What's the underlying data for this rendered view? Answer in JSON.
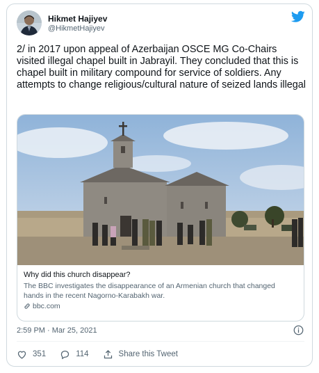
{
  "author": {
    "name": "Hikmet Hajiyev",
    "handle": "@HikmetHajiyev"
  },
  "tweet": {
    "text": "2/ in 2017 upon appeal of Azerbaijan OSCE MG Co-Chairs visited illegal chapel built in Jabrayil. They concluded that this is chapel built in military compound for service of soldiers. Any attempts to change religious/cultural nature of seized lands illegal",
    "timestamp": "2:59 PM · Mar 25, 2021"
  },
  "link_card": {
    "title": "Why did this church disappear?",
    "description": "The BBC investigates the disappearance of an Armenian church that changed hands in the recent Nagorno-Karabakh war.",
    "domain": "bbc.com"
  },
  "actions": {
    "likes": "351",
    "replies": "114",
    "share_label": "Share this Tweet"
  },
  "colors": {
    "twitter_blue": "#1d9bf0",
    "text_primary": "#0f1419",
    "text_secondary": "#536471",
    "border": "#cfd9de"
  },
  "icons": [
    "twitter-bird-icon",
    "info-icon",
    "heart-icon",
    "reply-icon",
    "share-icon",
    "link-icon"
  ]
}
